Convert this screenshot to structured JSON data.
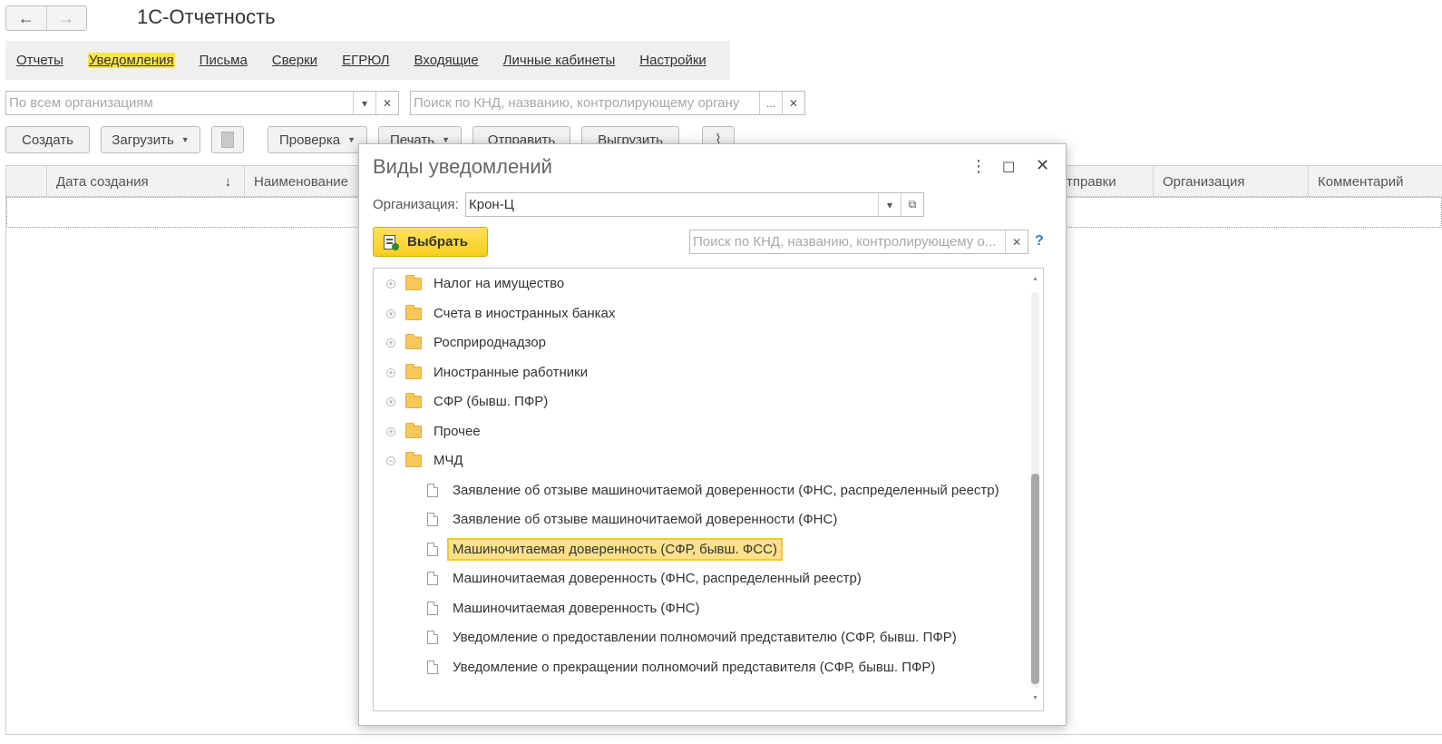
{
  "app": {
    "title": "1С-Отчетность"
  },
  "nav": {
    "back_icon": "←",
    "forward_icon": "→"
  },
  "tabs": [
    {
      "label": "Отчеты"
    },
    {
      "label": "Уведомления"
    },
    {
      "label": "Письма"
    },
    {
      "label": "Сверки"
    },
    {
      "label": "ЕГРЮЛ"
    },
    {
      "label": "Входящие"
    },
    {
      "label": "Личные кабинеты"
    },
    {
      "label": "Настройки"
    }
  ],
  "filters": {
    "org_placeholder": "По всем организациям",
    "search_placeholder": "Поиск по КНД, названию, контролирующему органу",
    "dots": "..."
  },
  "toolbar": {
    "create": "Создать",
    "load": "Загрузить",
    "check": "Проверка",
    "print": "Печать",
    "send": "Отправить",
    "upload": "Выгрузить"
  },
  "grid": {
    "columns": [
      "Дата создания",
      "Наименование",
      "отправки",
      "Организация",
      "Комментарий"
    ],
    "sort_icon": "↓"
  },
  "dialog": {
    "title": "Виды уведомлений",
    "org_label": "Организация:",
    "org_value": "Крон-Ц",
    "choose_label": "Выбрать",
    "search_placeholder": "Поиск по КНД, названию, контролирующему о...",
    "help": "?",
    "tree": [
      {
        "label": "Налог на имущество",
        "type": "folder",
        "expanded": false
      },
      {
        "label": "Счета в иностранных банках",
        "type": "folder",
        "expanded": false
      },
      {
        "label": "Росприроднадзор",
        "type": "folder",
        "expanded": false
      },
      {
        "label": "Иностранные работники",
        "type": "folder",
        "expanded": false
      },
      {
        "label": "СФР (бывш. ПФР)",
        "type": "folder",
        "expanded": false
      },
      {
        "label": "Прочее",
        "type": "folder",
        "expanded": false
      },
      {
        "label": "МЧД",
        "type": "folder",
        "expanded": true
      },
      {
        "label": "Заявление об отзыве машиночитаемой доверенности (ФНС, распределенный реестр)",
        "type": "doc"
      },
      {
        "label": "Заявление об отзыве машиночитаемой доверенности (ФНС)",
        "type": "doc"
      },
      {
        "label": "Машиночитаемая доверенность (СФР, бывш. ФСС)",
        "type": "doc",
        "selected": true
      },
      {
        "label": "Машиночитаемая доверенность (ФНС, распределенный реестр)",
        "type": "doc"
      },
      {
        "label": "Машиночитаемая доверенность (ФНС)",
        "type": "doc"
      },
      {
        "label": "Уведомление о предоставлении полномочий представителю (СФР, бывш. ПФР)",
        "type": "doc"
      },
      {
        "label": "Уведомление о прекращении полномочий представителя (СФР, бывш. ПФР)",
        "type": "doc"
      }
    ]
  }
}
